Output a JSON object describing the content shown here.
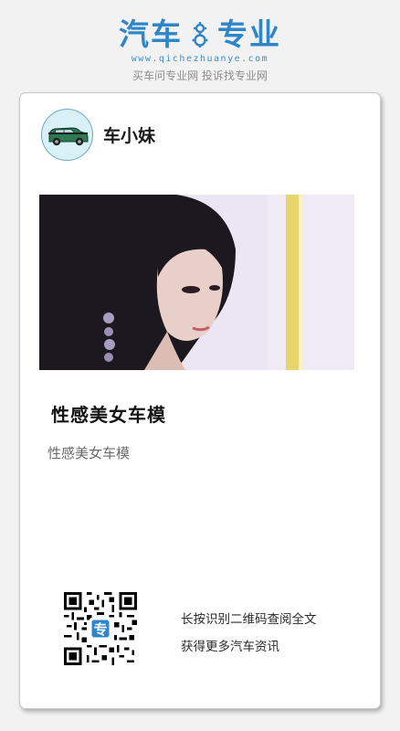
{
  "brand": {
    "name_left": "汽车",
    "name_right": "专业",
    "url": "www.qichezhuanye.com",
    "slogan": "买车问专业网 投诉找专业网",
    "color": "#2e86c8",
    "icon": "gear-icon"
  },
  "author": {
    "name": "车小妹",
    "avatar_icon": "car-icon"
  },
  "article": {
    "title": "性感美女车模",
    "summary": "性感美女车模"
  },
  "share": {
    "line1": "长按识别二维码查阅全文",
    "line2": "获得更多汽车资讯",
    "qr_center_label": "专"
  }
}
